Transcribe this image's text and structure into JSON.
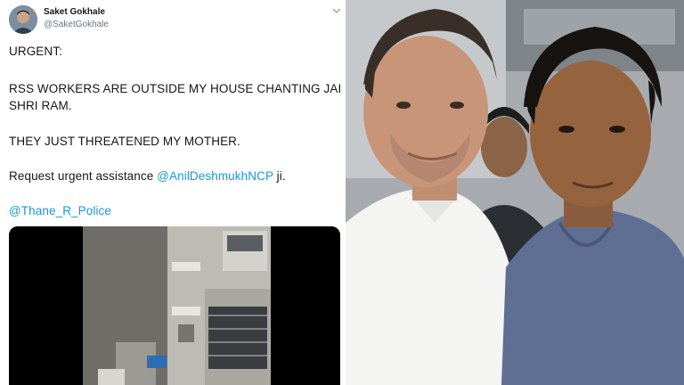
{
  "tweet": {
    "author": {
      "name": "Saket Gokhale",
      "handle": "@SaketGokhale"
    },
    "lines": [
      "URGENT:",
      "RSS WORKERS ARE OUTSIDE MY HOUSE CHANTING JAI",
      "SHRI RAM.",
      "THEY JUST THREATENED MY MOTHER.",
      "Request urgent assistance ",
      "@AnilDeshmukhNCP",
      " ji.",
      "@Thane_R_Police"
    ],
    "icons": {
      "more": "chevron-down-icon",
      "avatar": "avatar"
    },
    "colors": {
      "text": "#14171a",
      "mention": "#1b95e0",
      "secondary": "#657786"
    }
  },
  "media": {
    "type": "video-thumbnail"
  },
  "photo": {
    "description_icon": "photo"
  }
}
